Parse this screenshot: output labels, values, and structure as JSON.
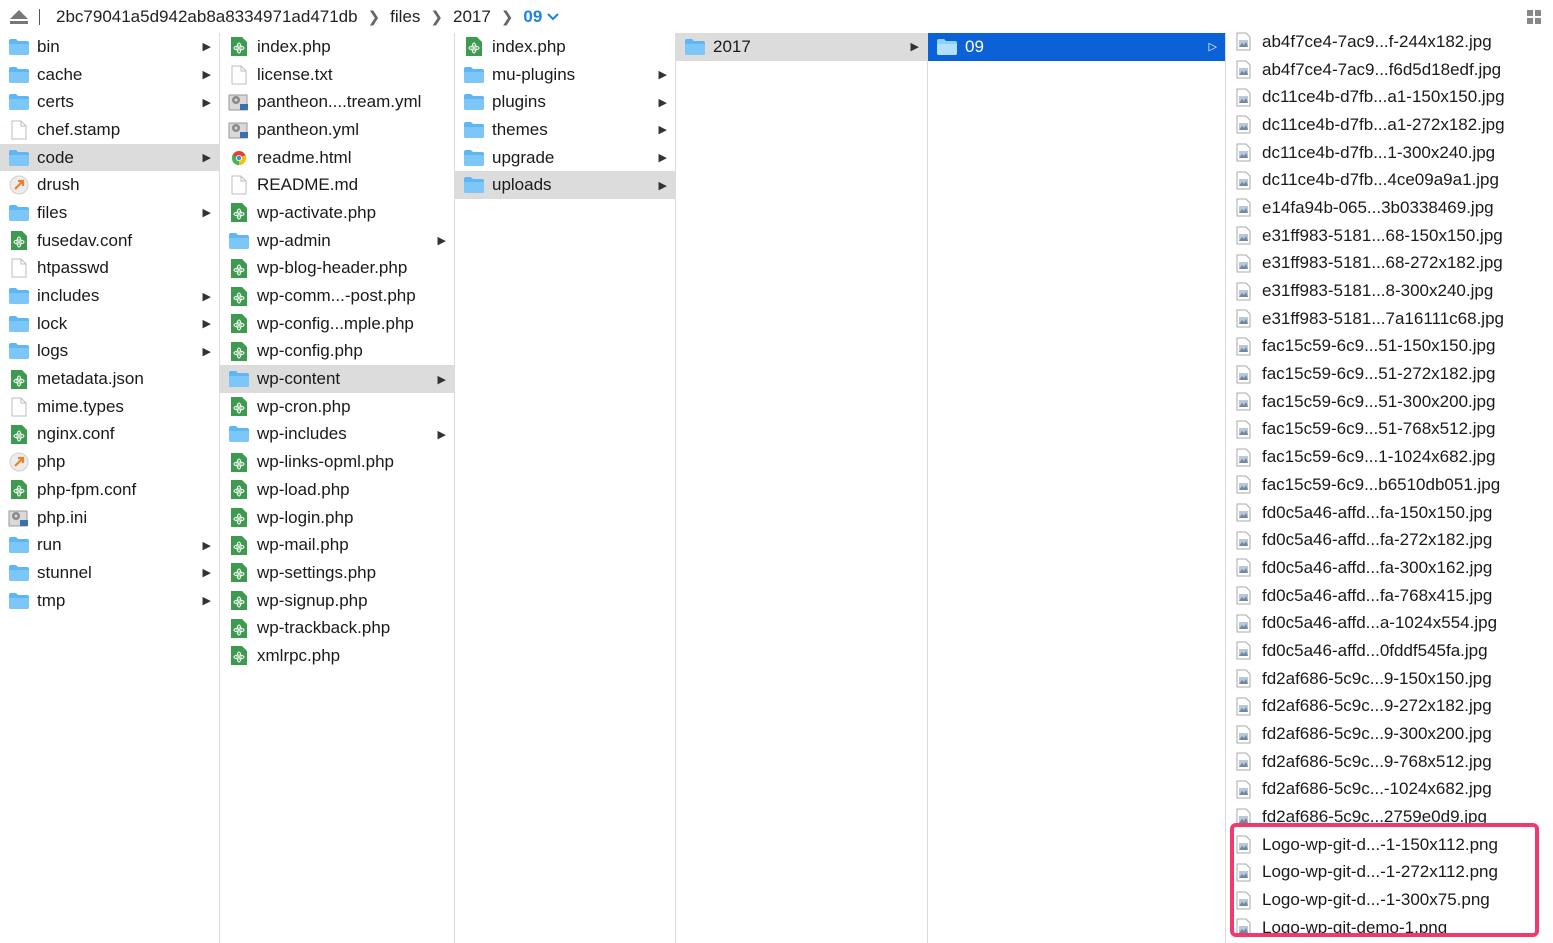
{
  "pathbar": {
    "crumbs": [
      "2bc79041a5d942ab8a8334971ad471db",
      "files",
      "2017"
    ],
    "current": "09"
  },
  "colors": {
    "accent": "#0b62d6",
    "selected": "#dcdcdc",
    "highlight": "#f03a6c",
    "folder": "#5fb6f4"
  },
  "col1": [
    {
      "name": "bin",
      "type": "folder",
      "arrow": true
    },
    {
      "name": "cache",
      "type": "folder",
      "arrow": true
    },
    {
      "name": "certs",
      "type": "folder",
      "arrow": true
    },
    {
      "name": "chef.stamp",
      "type": "doc"
    },
    {
      "name": "code",
      "type": "folder",
      "arrow": true,
      "state": "sel"
    },
    {
      "name": "drush",
      "type": "exec"
    },
    {
      "name": "files",
      "type": "folder",
      "arrow": true
    },
    {
      "name": "fusedav.conf",
      "type": "atom"
    },
    {
      "name": "htpasswd",
      "type": "doc"
    },
    {
      "name": "includes",
      "type": "folder",
      "arrow": true
    },
    {
      "name": "lock",
      "type": "folder",
      "arrow": true
    },
    {
      "name": "logs",
      "type": "folder",
      "arrow": true
    },
    {
      "name": "metadata.json",
      "type": "atom"
    },
    {
      "name": "mime.types",
      "type": "doc"
    },
    {
      "name": "nginx.conf",
      "type": "atom"
    },
    {
      "name": "php",
      "type": "exec"
    },
    {
      "name": "php-fpm.conf",
      "type": "atom"
    },
    {
      "name": "php.ini",
      "type": "settings"
    },
    {
      "name": "run",
      "type": "folder",
      "arrow": true
    },
    {
      "name": "stunnel",
      "type": "folder",
      "arrow": true
    },
    {
      "name": "tmp",
      "type": "folder",
      "arrow": true
    }
  ],
  "col2": [
    {
      "name": "index.php",
      "type": "atom"
    },
    {
      "name": "license.txt",
      "type": "doc"
    },
    {
      "name": "pantheon....tream.yml",
      "type": "settings"
    },
    {
      "name": "pantheon.yml",
      "type": "settings"
    },
    {
      "name": "readme.html",
      "type": "chrome"
    },
    {
      "name": "README.md",
      "type": "doc"
    },
    {
      "name": "wp-activate.php",
      "type": "atom"
    },
    {
      "name": "wp-admin",
      "type": "folder",
      "arrow": true
    },
    {
      "name": "wp-blog-header.php",
      "type": "atom"
    },
    {
      "name": "wp-comm...-post.php",
      "type": "atom"
    },
    {
      "name": "wp-config...mple.php",
      "type": "atom"
    },
    {
      "name": "wp-config.php",
      "type": "atom"
    },
    {
      "name": "wp-content",
      "type": "folder",
      "arrow": true,
      "state": "sel"
    },
    {
      "name": "wp-cron.php",
      "type": "atom"
    },
    {
      "name": "wp-includes",
      "type": "folder",
      "arrow": true
    },
    {
      "name": "wp-links-opml.php",
      "type": "atom"
    },
    {
      "name": "wp-load.php",
      "type": "atom"
    },
    {
      "name": "wp-login.php",
      "type": "atom"
    },
    {
      "name": "wp-mail.php",
      "type": "atom"
    },
    {
      "name": "wp-settings.php",
      "type": "atom"
    },
    {
      "name": "wp-signup.php",
      "type": "atom"
    },
    {
      "name": "wp-trackback.php",
      "type": "atom"
    },
    {
      "name": "xmlrpc.php",
      "type": "atom"
    }
  ],
  "col3": [
    {
      "name": "index.php",
      "type": "atom"
    },
    {
      "name": "mu-plugins",
      "type": "folder",
      "arrow": true
    },
    {
      "name": "plugins",
      "type": "folder",
      "arrow": true
    },
    {
      "name": "themes",
      "type": "folder",
      "arrow": true
    },
    {
      "name": "upgrade",
      "type": "folder",
      "arrow": true
    },
    {
      "name": "uploads",
      "type": "folder",
      "arrow": true,
      "state": "sel"
    }
  ],
  "col4": [
    {
      "name": "2017",
      "type": "folder",
      "arrow": true,
      "state": "sel"
    }
  ],
  "col5": [
    {
      "name": "09",
      "type": "folder",
      "arrow": true,
      "state": "active"
    }
  ],
  "col6": [
    {
      "name": "ab4f7ce4-7ac9...f-244x182.jpg"
    },
    {
      "name": "ab4f7ce4-7ac9...f6d5d18edf.jpg"
    },
    {
      "name": "dc11ce4b-d7fb...a1-150x150.jpg"
    },
    {
      "name": "dc11ce4b-d7fb...a1-272x182.jpg"
    },
    {
      "name": "dc11ce4b-d7fb...1-300x240.jpg"
    },
    {
      "name": "dc11ce4b-d7fb...4ce09a9a1.jpg"
    },
    {
      "name": "e14fa94b-065...3b0338469.jpg"
    },
    {
      "name": "e31ff983-5181...68-150x150.jpg"
    },
    {
      "name": "e31ff983-5181...68-272x182.jpg"
    },
    {
      "name": "e31ff983-5181...8-300x240.jpg"
    },
    {
      "name": "e31ff983-5181...7a16111c68.jpg"
    },
    {
      "name": "fac15c59-6c9...51-150x150.jpg"
    },
    {
      "name": "fac15c59-6c9...51-272x182.jpg"
    },
    {
      "name": "fac15c59-6c9...51-300x200.jpg"
    },
    {
      "name": "fac15c59-6c9...51-768x512.jpg"
    },
    {
      "name": "fac15c59-6c9...1-1024x682.jpg"
    },
    {
      "name": "fac15c59-6c9...b6510db051.jpg"
    },
    {
      "name": "fd0c5a46-affd...fa-150x150.jpg"
    },
    {
      "name": "fd0c5a46-affd...fa-272x182.jpg"
    },
    {
      "name": "fd0c5a46-affd...fa-300x162.jpg"
    },
    {
      "name": "fd0c5a46-affd...fa-768x415.jpg"
    },
    {
      "name": "fd0c5a46-affd...a-1024x554.jpg"
    },
    {
      "name": "fd0c5a46-affd...0fddf545fa.jpg"
    },
    {
      "name": "fd2af686-5c9c...9-150x150.jpg"
    },
    {
      "name": "fd2af686-5c9c...9-272x182.jpg"
    },
    {
      "name": "fd2af686-5c9c...9-300x200.jpg"
    },
    {
      "name": "fd2af686-5c9c...9-768x512.jpg"
    },
    {
      "name": "fd2af686-5c9c...-1024x682.jpg"
    },
    {
      "name": "fd2af686-5c9c...2759e0d9.jpg"
    },
    {
      "name": "Logo-wp-git-d...-1-150x112.png"
    },
    {
      "name": "Logo-wp-git-d...-1-272x112.png"
    },
    {
      "name": "Logo-wp-git-d...-1-300x75.png"
    },
    {
      "name": "Logo-wp-git-demo-1.png"
    }
  ]
}
